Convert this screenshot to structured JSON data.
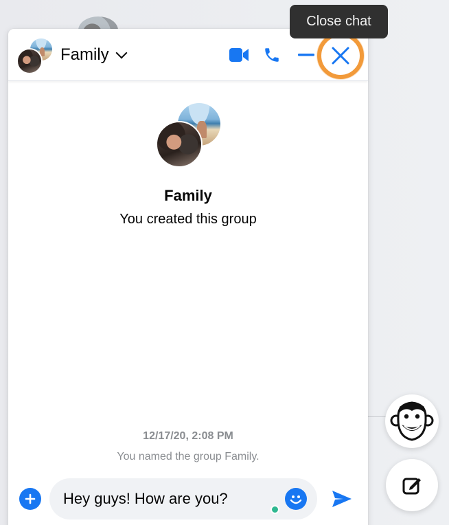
{
  "tooltip": {
    "text": "Close chat"
  },
  "chat": {
    "title": "Family",
    "group_name": "Family",
    "group_subtitle": "You created this group",
    "timestamp": "12/17/20, 2:08 PM",
    "event": "You named the group Family.",
    "message_input": "Hey guys! How are you?"
  },
  "header_icons": [
    "video-call-icon",
    "phone-icon",
    "minimize-icon",
    "close-icon"
  ],
  "composer_icons": [
    "plus-icon",
    "emoji-icon",
    "send-icon"
  ],
  "floating_icons": [
    "monkey-avatar-icon",
    "compose-icon"
  ],
  "colors": {
    "accent": "#1877f2",
    "highlight": "#f29a3a",
    "tooltip_bg": "#303030",
    "online": "#2fb890"
  }
}
